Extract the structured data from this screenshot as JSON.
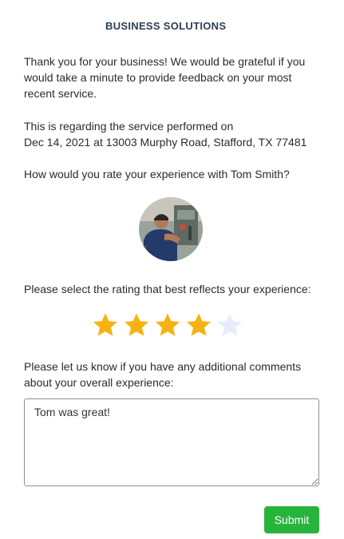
{
  "brand": {
    "tagline": "BUSINESS SOLUTIONS"
  },
  "intro": "Thank you for your business! We would be grateful if you would take a minute to provide feedback on your most recent service.",
  "service": {
    "line1": "This is regarding the service performed on",
    "line2": "Dec 14, 2021 at 13003 Murphy Road, Stafford, TX 77481"
  },
  "rating_question": "How would you rate your experience with Tom Smith?",
  "technician": {
    "name": "Tom Smith",
    "photo_icon": "technician-photo"
  },
  "rating_prompt": "Please select the rating that best reflects your experience:",
  "rating": {
    "value": 4,
    "max": 5,
    "filled_color": "#f6b20f",
    "empty_color": "#e6ecfa"
  },
  "comments": {
    "prompt": "Please let us know if you have any additional comments about your overall experience:",
    "value": "Tom was great!"
  },
  "submit_label": "Submit",
  "colors": {
    "submit": "#28b43c",
    "logo_red": "#e63a2e",
    "logo_blue": "#2a84c9",
    "tagline": "#2d3e50"
  }
}
